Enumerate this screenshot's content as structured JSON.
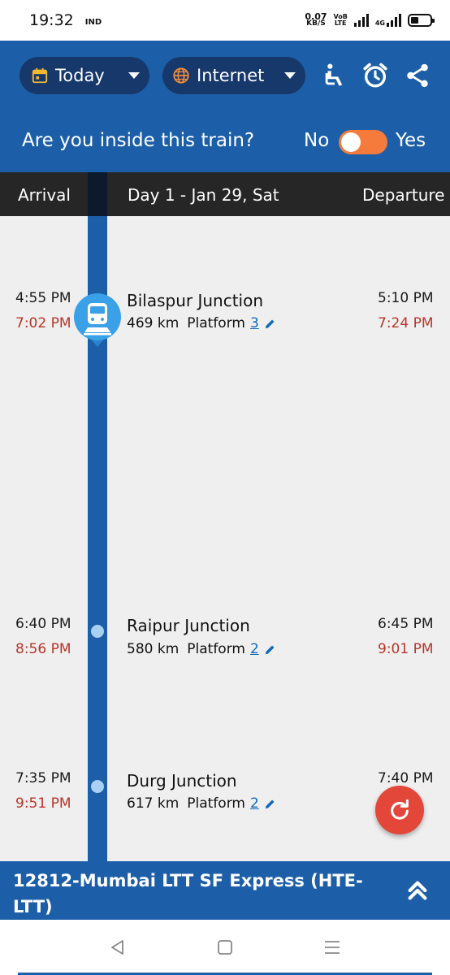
{
  "status_bar": {
    "time": "19:32",
    "carrier": "IND",
    "speed_value": "0.07",
    "speed_unit": "KB/S",
    "volte_top": "VoB",
    "volte_bottom": "LTE",
    "network": "4G"
  },
  "header": {
    "day_label": "Today",
    "source_label": "Internet",
    "inside_question": "Are you inside this train?",
    "toggle_no": "No",
    "toggle_yes": "Yes",
    "icons": [
      "calendar-icon",
      "globe-icon",
      "seat-icon",
      "alarm-clock-icon",
      "share-icon"
    ]
  },
  "columns": {
    "arrival": "Arrival",
    "day": "Day 1 - Jan 29, Sat",
    "departure": "Departure"
  },
  "stations": [
    {
      "name": "Bilaspur Junction",
      "km": "469 km",
      "platform_label": "Platform",
      "platform": "3",
      "arr_sched": "4:55 PM",
      "arr_actual": "7:02 PM",
      "dep_sched": "5:10 PM",
      "dep_actual": "7:24 PM",
      "current": true
    },
    {
      "name": "Raipur Junction",
      "km": "580 km",
      "platform_label": "Platform",
      "platform": "2",
      "arr_sched": "6:40 PM",
      "arr_actual": "8:56 PM",
      "dep_sched": "6:45 PM",
      "dep_actual": "9:01 PM",
      "current": false
    },
    {
      "name": "Durg Junction",
      "km": "617 km",
      "platform_label": "Platform",
      "platform": "2",
      "arr_sched": "7:35 PM",
      "arr_actual": "9:51 PM",
      "dep_sched": "7:40 PM",
      "dep_actual": "",
      "current": false
    }
  ],
  "train": {
    "name": "12812-Mumbai LTT SF Express (HTE-LTT)"
  },
  "colors": {
    "primary_blue": "#1c5fa8",
    "dark_pill": "#16386b",
    "toggle_orange": "#f47b3b",
    "delay_red": "#b8352a",
    "fab_red": "#e2473a",
    "column_bar": "#262626"
  }
}
